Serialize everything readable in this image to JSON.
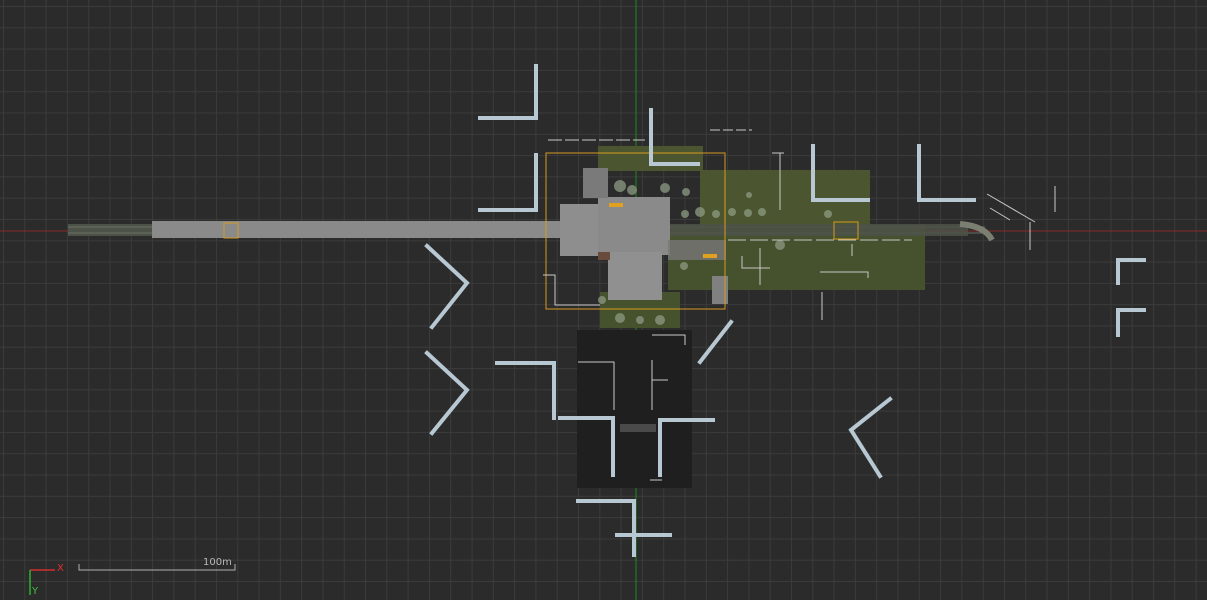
{
  "viewport": {
    "scale_bar_label": "100m",
    "axis_x_label": "X",
    "axis_y_label": "Y"
  },
  "colors": {
    "background": "#2b2b2b",
    "grid": "#3b3b3b",
    "axis_x": "#c03030",
    "axis_y": "#2fa02f",
    "selection": "#e0a020",
    "wall": "#b9c9d2",
    "grass": "#4a5530",
    "platform": "#8a8a8a"
  }
}
